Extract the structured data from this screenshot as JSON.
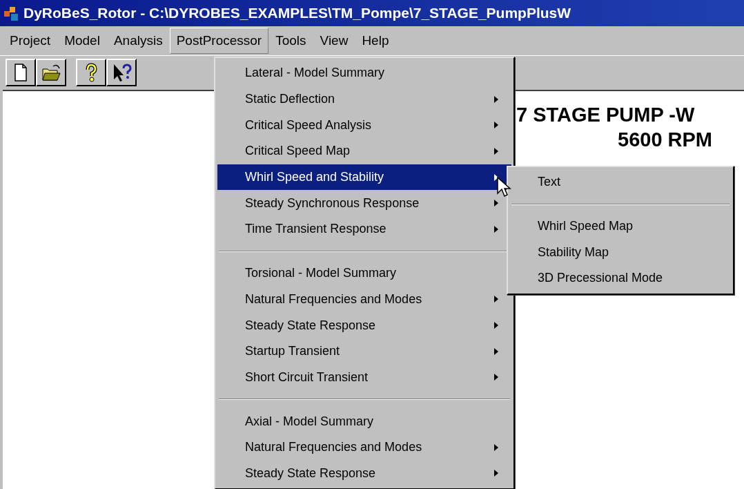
{
  "window": {
    "title": "DyRoBeS_Rotor - C:\\DYROBES_EXAMPLES\\TM_Pompe\\7_STAGE_PumpPlusW"
  },
  "menu_bar": [
    {
      "label": "Project",
      "selected": false
    },
    {
      "label": "Model",
      "selected": false
    },
    {
      "label": "Analysis",
      "selected": false
    },
    {
      "label": "PostProcessor",
      "selected": true
    },
    {
      "label": "Tools",
      "selected": false
    },
    {
      "label": "View",
      "selected": false
    },
    {
      "label": "Help",
      "selected": false
    }
  ],
  "toolbar": [
    {
      "kind": "new"
    },
    {
      "kind": "open"
    },
    {
      "kind": "gap"
    },
    {
      "kind": "help"
    },
    {
      "kind": "context-help"
    }
  ],
  "document": {
    "lines": [
      "7 STAGE PUMP -W",
      "5600 RPM"
    ]
  },
  "menu": [
    {
      "kind": "item",
      "label": "Lateral - Model Summary",
      "submenu": false,
      "selected": false
    },
    {
      "kind": "item",
      "label": "Static Deflection",
      "submenu": true,
      "selected": false
    },
    {
      "kind": "item",
      "label": "Critical Speed Analysis",
      "submenu": true,
      "selected": false
    },
    {
      "kind": "item",
      "label": "Critical Speed Map",
      "submenu": true,
      "selected": false
    },
    {
      "kind": "item",
      "label": "Whirl Speed and Stability",
      "submenu": true,
      "selected": true
    },
    {
      "kind": "item",
      "label": "Steady Synchronous Response",
      "submenu": true,
      "selected": false
    },
    {
      "kind": "item",
      "label": "Time Transient Response",
      "submenu": true,
      "selected": false
    },
    {
      "kind": "separator"
    },
    {
      "kind": "item",
      "label": "Torsional - Model Summary",
      "submenu": false,
      "selected": false
    },
    {
      "kind": "item",
      "label": "Natural Frequencies and Modes",
      "submenu": true,
      "selected": false
    },
    {
      "kind": "item",
      "label": "Steady State Response",
      "submenu": true,
      "selected": false
    },
    {
      "kind": "item",
      "label": "Startup Transient",
      "submenu": true,
      "selected": false
    },
    {
      "kind": "item",
      "label": "Short Circuit Transient",
      "submenu": true,
      "selected": false
    },
    {
      "kind": "separator"
    },
    {
      "kind": "item",
      "label": "Axial - Model Summary",
      "submenu": false,
      "selected": false
    },
    {
      "kind": "item",
      "label": "Natural Frequencies and Modes",
      "submenu": true,
      "selected": false
    },
    {
      "kind": "item",
      "label": "Steady State Response",
      "submenu": true,
      "selected": false
    }
  ],
  "submenu": [
    {
      "kind": "item",
      "label": "Text",
      "selected": false
    },
    {
      "kind": "separator"
    },
    {
      "kind": "item",
      "label": "Whirl Speed Map",
      "selected": false
    },
    {
      "kind": "item",
      "label": "Stability Map",
      "selected": false
    },
    {
      "kind": "item",
      "label": "3D Precessional Mode",
      "selected": false
    }
  ]
}
